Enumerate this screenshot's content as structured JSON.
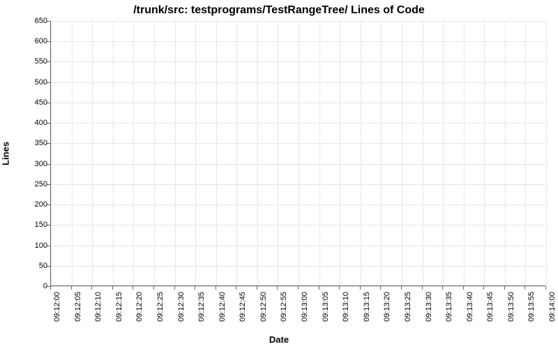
{
  "chart_data": {
    "type": "line",
    "title": "/trunk/src: testprograms/TestRangeTree/ Lines of Code",
    "xlabel": "Date",
    "ylabel": "Lines",
    "ylim": [
      0,
      650
    ],
    "y_ticks": [
      0,
      50,
      100,
      150,
      200,
      250,
      300,
      350,
      400,
      450,
      500,
      550,
      600,
      650
    ],
    "x_ticks": [
      "09:12:00",
      "09:12:05",
      "09:12:10",
      "09:12:15",
      "09:12:20",
      "09:12:25",
      "09:12:30",
      "09:12:35",
      "09:12:40",
      "09:12:45",
      "09:12:50",
      "09:12:55",
      "09:13:00",
      "09:13:05",
      "09:13:10",
      "09:13:15",
      "09:13:20",
      "09:13:25",
      "09:13:30",
      "09:13:35",
      "09:13:40",
      "09:13:45",
      "09:13:50",
      "09:13:55",
      "09:14:00"
    ],
    "series": []
  }
}
